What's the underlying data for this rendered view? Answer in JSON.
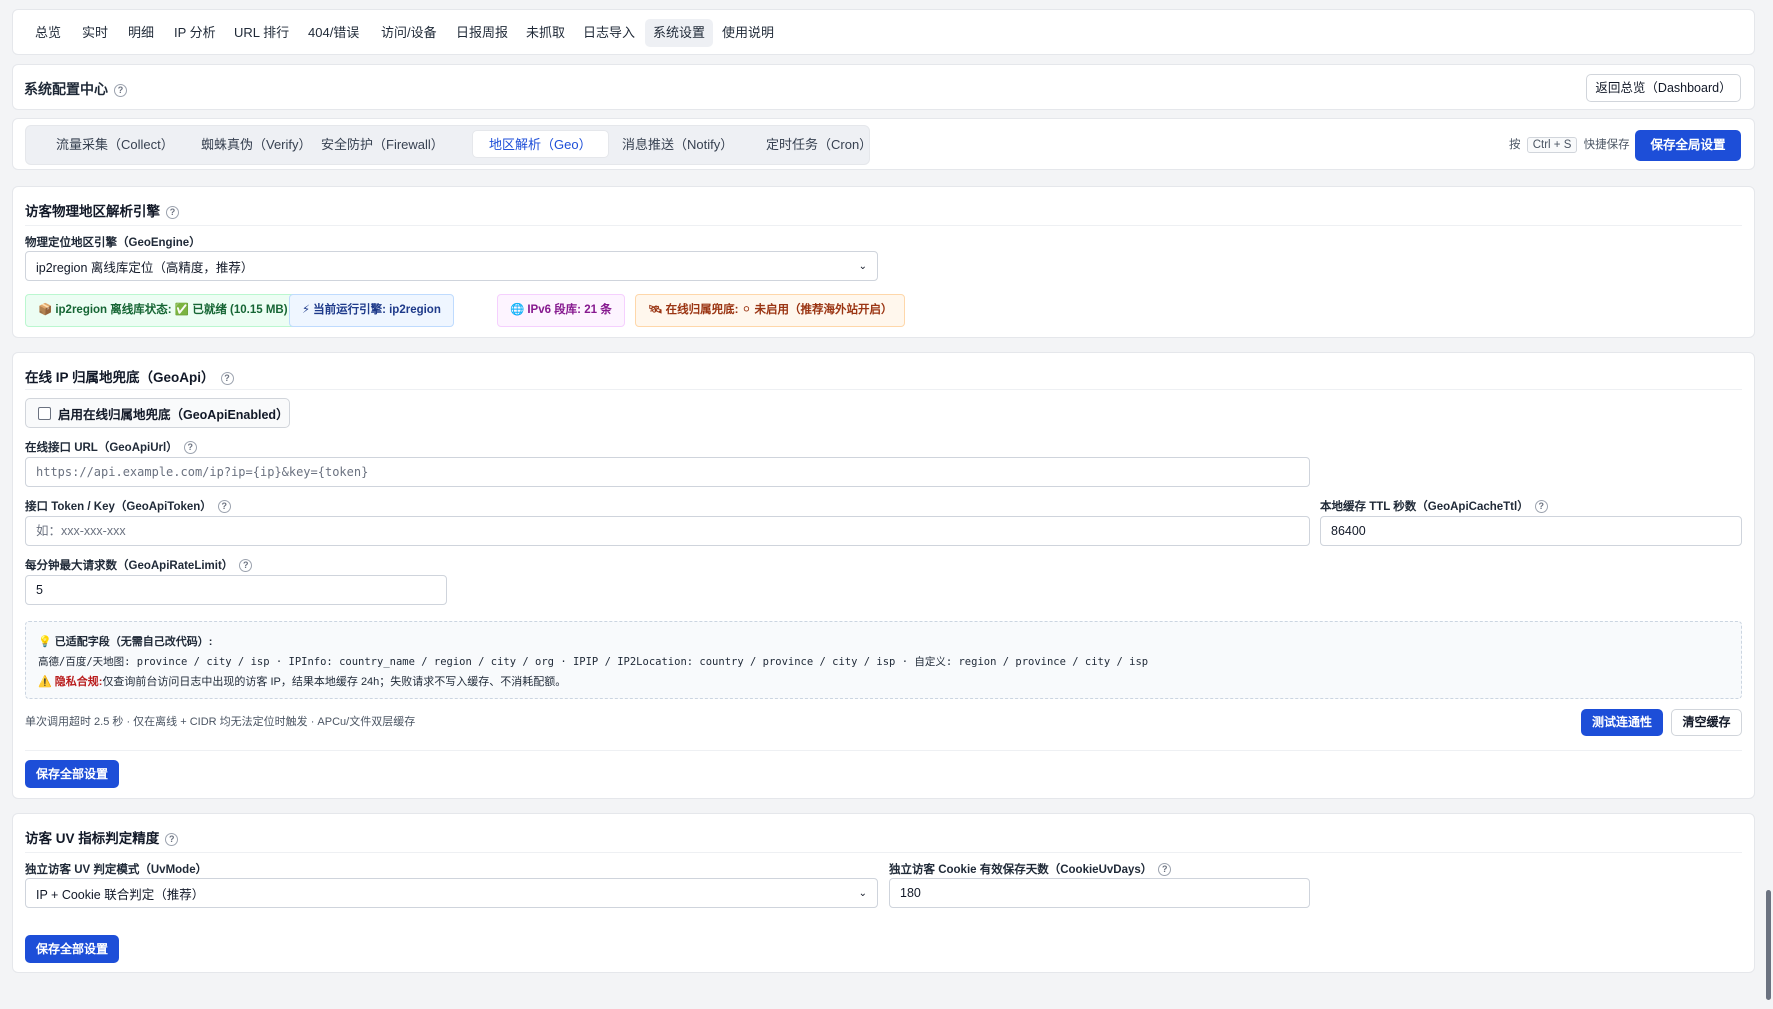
{
  "nav": {
    "items": [
      "总览",
      "实时",
      "明细",
      "IP 分析",
      "URL 排行",
      "404/错误",
      "访问/设备",
      "日报周报",
      "未抓取",
      "日志导入",
      "系统设置",
      "使用说明"
    ],
    "active": "系统设置"
  },
  "header": {
    "title": "系统配置中心",
    "back_button": "返回总览（Dashboard）"
  },
  "tabs": {
    "items": [
      "流量采集（Collect）",
      "蜘蛛真伪（Verify）",
      "安全防护（Firewall）",
      "地区解析（Geo）",
      "消息推送（Notify）",
      "定时任务（Cron）"
    ],
    "active": "地区解析（Geo）",
    "shortcut_prefix": "按",
    "shortcut_key": "Ctrl + S",
    "shortcut_suffix": "快捷保存",
    "save_global": "保存全局设置"
  },
  "geo_engine": {
    "title": "访客物理地区解析引擎",
    "engine_label": "物理定位地区引擎（GeoEngine）",
    "engine_value": "ip2region 离线库定位（高精度，推荐）",
    "badges": [
      {
        "icon": "📦",
        "text": "ip2region 离线库状态: ✅ 已就绪 (10.15 MB)",
        "bg": "#ecfdf3",
        "border": "#bbf7d0",
        "color": "#166534"
      },
      {
        "icon": "⚡",
        "text": "当前运行引擎: ip2region",
        "bg": "#eff6ff",
        "border": "#bfdbfe",
        "color": "#1e3a8a"
      },
      {
        "icon": "🌐",
        "text": "IPv6 段库: 21 条",
        "bg": "#fdf4ff",
        "border": "#f5d0fe",
        "color": "#86198f"
      },
      {
        "icon": "🛰",
        "text": "在线归属兜底: ⚪ 未启用（推荐海外站开启）",
        "bg": "#fff7ed",
        "border": "#fed7aa",
        "color": "#9a3412"
      }
    ]
  },
  "geo_api": {
    "title": "在线 IP 归属地兜底（GeoApi）",
    "enable_label": "启用在线归属地兜底（GeoApiEnabled）",
    "enabled": false,
    "url_label": "在线接口 URL（GeoApiUrl）",
    "url_placeholder": "https://api.example.com/ip?ip={ip}&key={token}",
    "token_label": "接口 Token / Key（GeoApiToken）",
    "token_placeholder": "如：xxx-xxx-xxx",
    "ttl_label": "本地缓存 TTL 秒数（GeoApiCacheTtl）",
    "ttl_value": "86400",
    "rate_label": "每分钟最大请求数（GeoApiRateLimit）",
    "rate_value": "5",
    "info_title": "已适配字段（无需自己改代码）:",
    "info_fields": "高德/百度/天地图: province / city / isp · IPInfo: country_name / region / city / org · IPIP / IP2Location: country / province / city / isp · 自定义: region / province / city / isp",
    "privacy_label": "隐私合规:",
    "privacy_text": "仅查询前台访问日志中出现的访客 IP，结果本地缓存 24h；失败请求不写入缓存、不消耗配额。",
    "footer_note": "单次调用超时 2.5 秒 · 仅在离线 + CIDR 均无法定位时触发 · APCu/文件双层缓存",
    "test_button": "测试连通性",
    "clear_button": "清空缓存",
    "save_button": "保存全部设置"
  },
  "uv": {
    "title": "访客 UV 指标判定精度",
    "mode_label": "独立访客 UV 判定模式（UvMode）",
    "mode_value": "IP + Cookie 联合判定（推荐）",
    "cookie_label": "独立访客 Cookie 有效保存天数（CookieUvDays）",
    "cookie_value": "180",
    "save_button": "保存全部设置"
  },
  "colors": {
    "accent": "#1d4ed8",
    "border": "#e5e7eb"
  }
}
